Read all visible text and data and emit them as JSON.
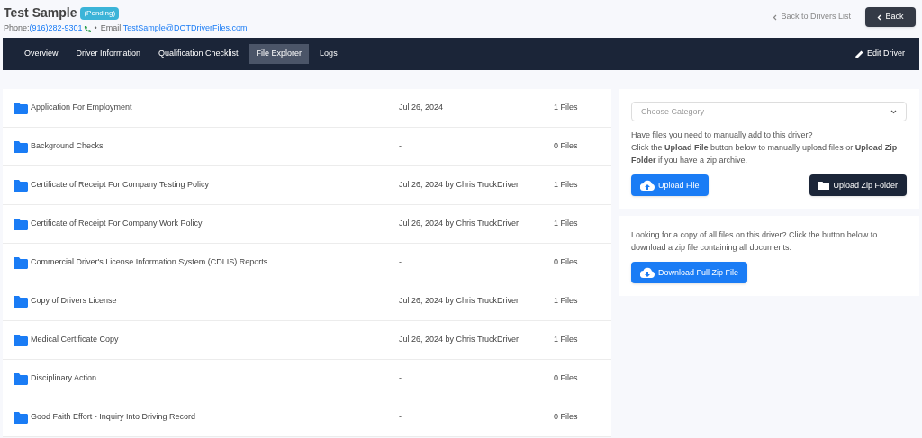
{
  "driver": {
    "name": "Test Sample",
    "status": "(Pending)",
    "phone_label": "Phone:",
    "phone": "(916)282-9301",
    "separator": "•",
    "email_label": "Email:",
    "email": "TestSample@DOTDriverFiles.com"
  },
  "back_link": "Back to Drivers List",
  "back_button": "Back",
  "tabs": [
    {
      "label": "Overview",
      "selected": false
    },
    {
      "label": "Driver Information",
      "selected": false
    },
    {
      "label": "Qualification Checklist",
      "selected": false
    },
    {
      "label": "File Explorer",
      "selected": true
    },
    {
      "label": "Logs",
      "selected": false
    }
  ],
  "edit_button": "Edit Driver",
  "folders": [
    {
      "name": "Application For Employment",
      "updated": "Jul 26, 2024",
      "count": "1 Files"
    },
    {
      "name": "Background Checks",
      "updated": "-",
      "count": "0 Files"
    },
    {
      "name": "Certificate of Receipt For Company Testing Policy",
      "updated": "Jul 26, 2024 by Chris TruckDriver",
      "count": "1 Files"
    },
    {
      "name": "Certificate of Receipt For Company Work Policy",
      "updated": "Jul 26, 2024 by Chris TruckDriver",
      "count": "1 Files"
    },
    {
      "name": "Commercial Driver's License Information System (CDLIS) Reports",
      "updated": "-",
      "count": "0 Files"
    },
    {
      "name": "Copy of Drivers License",
      "updated": "Jul 26, 2024 by Chris TruckDriver",
      "count": "1 Files"
    },
    {
      "name": "Medical Certificate Copy",
      "updated": "Jul 26, 2024 by Chris TruckDriver",
      "count": "1 Files"
    },
    {
      "name": "Disciplinary Action",
      "updated": "-",
      "count": "0 Files"
    },
    {
      "name": "Good Faith Effort - Inquiry Into Driving Record",
      "updated": "-",
      "count": "0 Files"
    }
  ],
  "upload_panel": {
    "category_placeholder": "Choose Category",
    "intro": "Have files you need to manually add to this driver?",
    "instructions": "Click the **Upload File** button below to manually upload files or **Upload Zip Folder** if you have a zip archive.",
    "upload_button": "Upload File",
    "zip_button": "Upload Zip Folder"
  },
  "download_panel": {
    "text": "Looking for a copy of all files on this driver? Click the button below to download a zip file containing all documents.",
    "button": "Download Full Zip File"
  }
}
